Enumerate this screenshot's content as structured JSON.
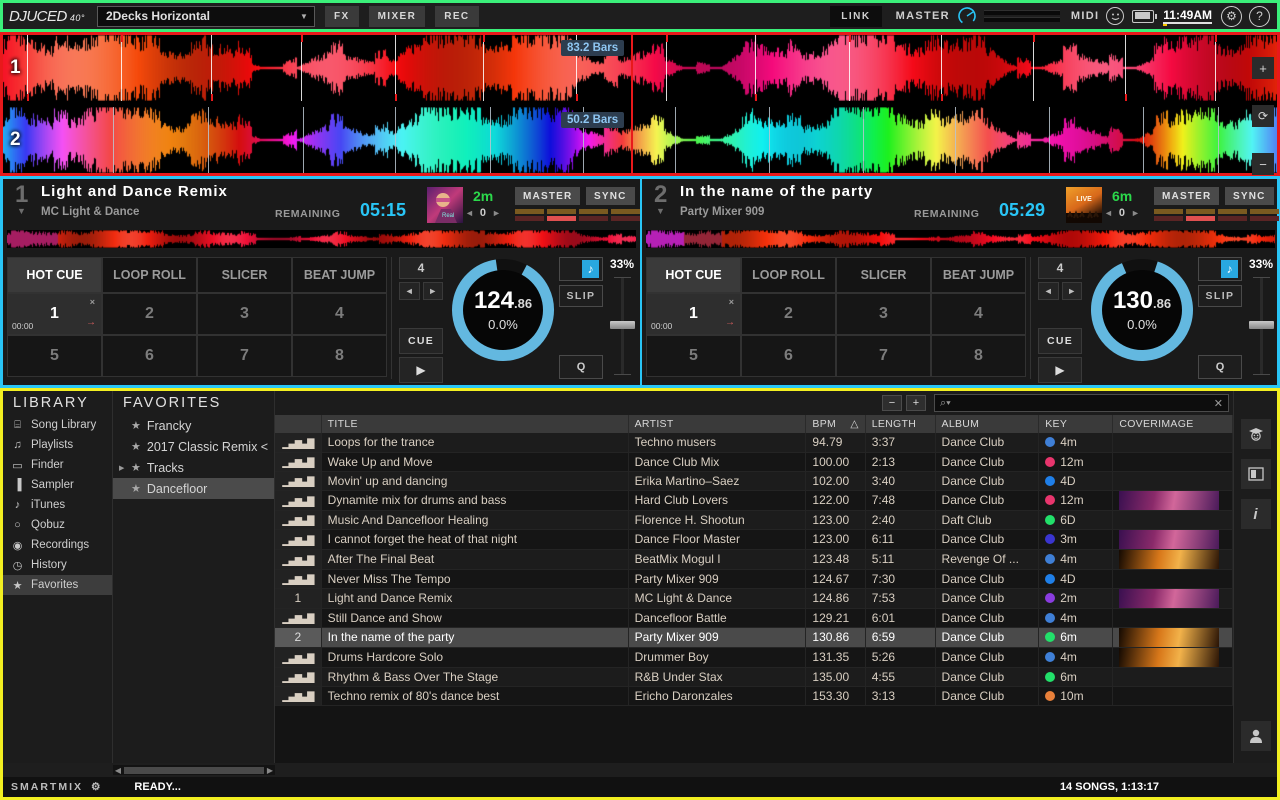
{
  "topbar": {
    "logo_main": "DJUCED",
    "logo_sup": "40°",
    "layout": "2Decks Horizontal",
    "caret": "▼",
    "fx": "FX",
    "mixer": "MIXER",
    "rec": "REC",
    "link": "LINK",
    "master": "MASTER",
    "midi": "MIDI",
    "clock": "11:49AM",
    "gear": "⚙",
    "help": "?"
  },
  "waveforms": {
    "deck1_num": "1",
    "deck2_num": "2",
    "deck1_bars": "83.2 Bars",
    "deck2_bars": "50.2 Bars",
    "zoom_in": "+",
    "zoom_sync": "⟳",
    "zoom_out": "−"
  },
  "decks": [
    {
      "index": "1",
      "caret": "▼",
      "title": "Light and Dance Remix",
      "artist": "MC Light & Dance",
      "remaining_label": "REMAINING",
      "remaining": "05:15",
      "key": "2m",
      "key_shift": "0",
      "arrow_left": "◄",
      "arrow_right": "►",
      "master": "MASTER",
      "sync": "SYNC",
      "pad_tabs": [
        "HOT CUE",
        "LOOP ROLL",
        "SLICER",
        "BEAT JUMP"
      ],
      "pads": [
        "1",
        "2",
        "3",
        "4",
        "5",
        "6",
        "7",
        "8"
      ],
      "pad1_time": "00:00",
      "pad1_delete": "×",
      "pad1_arrow": "→",
      "loop_size": "4",
      "cue": "CUE",
      "play": "▶",
      "bpm_int": "124",
      "bpm_dec": ".86",
      "pitch_pct": "0.0%",
      "note_icon": "♪",
      "slip": "SLIP",
      "q": "Q",
      "pitch_range": "33%"
    },
    {
      "index": "2",
      "caret": "▼",
      "title": "In the name of the party",
      "artist": "Party Mixer 909",
      "remaining_label": "REMAINING",
      "remaining": "05:29",
      "key": "6m",
      "key_shift": "0",
      "arrow_left": "◄",
      "arrow_right": "►",
      "master": "MASTER",
      "sync": "SYNC",
      "pad_tabs": [
        "HOT CUE",
        "LOOP ROLL",
        "SLICER",
        "BEAT JUMP"
      ],
      "pads": [
        "1",
        "2",
        "3",
        "4",
        "5",
        "6",
        "7",
        "8"
      ],
      "pad1_time": "00:00",
      "pad1_delete": "×",
      "pad1_arrow": "→",
      "loop_size": "4",
      "cue": "CUE",
      "play": "▶",
      "bpm_int": "130",
      "bpm_dec": ".86",
      "pitch_pct": "0.0%",
      "note_icon": "♪",
      "slip": "SLIP",
      "q": "Q",
      "pitch_range": "33%"
    }
  ],
  "library": {
    "header": "LIBRARY",
    "items": [
      {
        "label": "Song Library",
        "icon": "⌸"
      },
      {
        "label": "Playlists",
        "icon": "♫"
      },
      {
        "label": "Finder",
        "icon": "▭"
      },
      {
        "label": "Sampler",
        "icon": "▐"
      },
      {
        "label": "iTunes",
        "icon": "♪"
      },
      {
        "label": "Qobuz",
        "icon": "○"
      },
      {
        "label": "Recordings",
        "icon": "◉"
      },
      {
        "label": "History",
        "icon": "◷"
      },
      {
        "label": "Favorites",
        "icon": "★"
      }
    ],
    "active": "Favorites"
  },
  "favorites": {
    "header": "FAVORITES",
    "items": [
      {
        "label": "Francky",
        "star": "★",
        "expandable": false
      },
      {
        "label": "2017 Classic Remix <",
        "star": "★",
        "expandable": false
      },
      {
        "label": "Tracks",
        "star": "★",
        "expandable": true
      },
      {
        "label": "Dancefloor",
        "star": "★",
        "expandable": false
      }
    ],
    "active": "Dancefloor"
  },
  "search": {
    "minus": "−",
    "plus": "+",
    "icon": "⌕",
    "caret": "▾",
    "value": "",
    "clear": "✕"
  },
  "tracklist": {
    "columns": [
      "",
      "TITLE",
      "ARTIST",
      "BPM",
      "LENGTH",
      "ALBUM",
      "KEY",
      "COVERIMAGE"
    ],
    "sort_indicator": "△",
    "rows": [
      {
        "deck": "",
        "title": "Loops for the trance",
        "artist": "Techno musers",
        "bpm": "94.79",
        "length": "3:37",
        "album": "Dance Club",
        "key": "4m",
        "key_color": "#3f7fd6",
        "cover": "",
        "selected": false
      },
      {
        "deck": "",
        "title": "Wake Up and Move",
        "artist": "Dance Club Mix",
        "bpm": "100.00",
        "length": "2:13",
        "album": "Dance Club",
        "key": "12m",
        "key_color": "#e8356d",
        "cover": "",
        "selected": false
      },
      {
        "deck": "",
        "title": "Movin' up and dancing",
        "artist": "Erika Martino–Saez",
        "bpm": "102.00",
        "length": "3:40",
        "album": "Dance Club",
        "key": "4D",
        "key_color": "#1f7fe8",
        "cover": "",
        "selected": false
      },
      {
        "deck": "",
        "title": "Dynamite mix for drums and bass",
        "artist": "Hard Club Lovers",
        "bpm": "122.00",
        "length": "7:48",
        "album": "Dance Club",
        "key": "12m",
        "key_color": "#e8356d",
        "cover": "purple",
        "selected": false
      },
      {
        "deck": "",
        "title": "Music And Dancefloor Healing",
        "artist": "Florence H. Shootun",
        "bpm": "123.00",
        "length": "2:40",
        "album": "Daft Club",
        "key": "6D",
        "key_color": "#22e06a",
        "cover": "",
        "selected": false
      },
      {
        "deck": "",
        "title": "I cannot forget the heat of that night",
        "artist": "Dance Floor Master",
        "bpm": "123.00",
        "length": "6:11",
        "album": "Dance Club",
        "key": "3m",
        "key_color": "#3a35cf",
        "cover": "purple",
        "selected": false
      },
      {
        "deck": "",
        "title": "After The Final Beat",
        "artist": "BeatMix Mogul I",
        "bpm": "123.48",
        "length": "5:11",
        "album": "Revenge Of ...",
        "key": "4m",
        "key_color": "#3f7fd6",
        "cover": "orange",
        "selected": false
      },
      {
        "deck": "",
        "title": "Never Miss The Tempo",
        "artist": "Party Mixer 909",
        "bpm": "124.67",
        "length": "7:30",
        "album": "Dance Club",
        "key": "4D",
        "key_color": "#1f7fe8",
        "cover": "",
        "selected": false
      },
      {
        "deck": "1",
        "title": "Light and Dance Remix",
        "artist": "MC Light & Dance",
        "bpm": "124.86",
        "length": "7:53",
        "album": "Dance Club",
        "key": "2m",
        "key_color": "#8a3ce0",
        "cover": "purple",
        "selected": false
      },
      {
        "deck": "",
        "title": "Still Dance and Show",
        "artist": "Dancefloor Battle",
        "bpm": "129.21",
        "length": "6:01",
        "album": "Dance Club",
        "key": "4m",
        "key_color": "#3f7fd6",
        "cover": "",
        "selected": false
      },
      {
        "deck": "2",
        "title": "In the name of the party",
        "artist": "Party Mixer 909",
        "bpm": "130.86",
        "length": "6:59",
        "album": "Dance Club",
        "key": "6m",
        "key_color": "#22e06a",
        "cover": "orange",
        "selected": true
      },
      {
        "deck": "",
        "title": "Drums Hardcore Solo",
        "artist": "Drummer Boy",
        "bpm": "131.35",
        "length": "5:26",
        "album": "Dance Club",
        "key": "4m",
        "key_color": "#3f7fd6",
        "cover": "orange",
        "selected": false
      },
      {
        "deck": "",
        "title": "Rhythm & Bass Over The Stage",
        "artist": "R&B Under Stax",
        "bpm": "135.00",
        "length": "4:55",
        "album": "Dance Club",
        "key": "6m",
        "key_color": "#22e06a",
        "cover": "",
        "selected": false
      },
      {
        "deck": "",
        "title": "Techno remix of 80's dance best",
        "artist": "Ericho Daronzales",
        "bpm": "153.30",
        "length": "3:13",
        "album": "Dance Club",
        "key": "10m",
        "key_color": "#e8803a",
        "cover": "",
        "selected": false
      }
    ]
  },
  "rail": {
    "tutor": "☻",
    "panels": "▣",
    "info": "i",
    "user": "♟"
  },
  "status": {
    "smartmix": "SMARTMIX",
    "gear": "⚙",
    "ready": "READY...",
    "songs": "14 SONGS, 1:13:17"
  },
  "colors": {
    "green_frame": "#3bf07a",
    "red_frame": "#e8191b",
    "cyan_frame": "#29c5f6",
    "yellow_frame": "#f2ef21",
    "accent_blue": "#29c5f6"
  }
}
